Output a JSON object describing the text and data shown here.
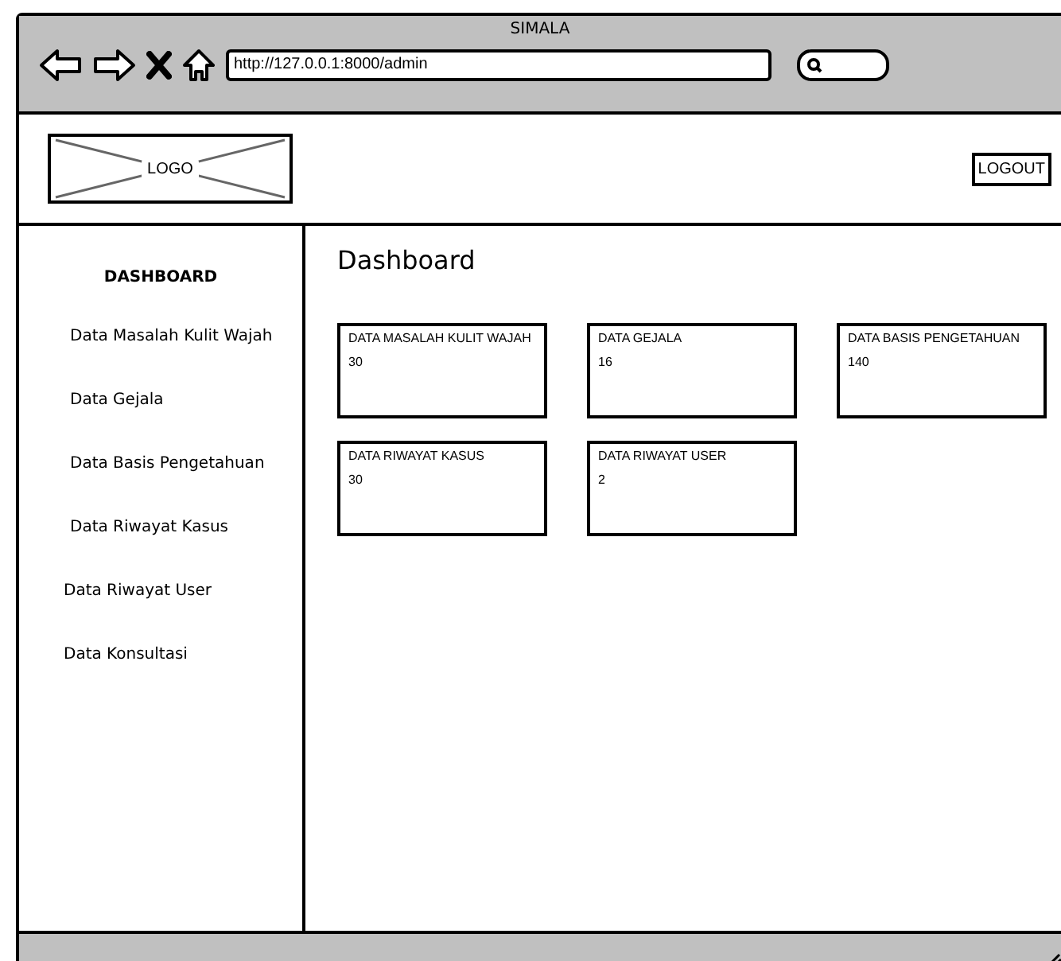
{
  "window": {
    "title": "SIMALA"
  },
  "browser": {
    "url": "http://127.0.0.1:8000/admin"
  },
  "header": {
    "logo": "LOGO",
    "logout": "LOGOUT"
  },
  "sidebar": {
    "title": "DASHBOARD",
    "items": [
      {
        "label": "Data Masalah Kulit Wajah"
      },
      {
        "label": "Data Gejala"
      },
      {
        "label": "Data Basis Pengetahuan"
      },
      {
        "label": "Data Riwayat Kasus"
      },
      {
        "label": "Data Riwayat User"
      },
      {
        "label": "Data Konsultasi"
      }
    ]
  },
  "main": {
    "heading": "Dashboard",
    "cards": [
      {
        "title": "DATA MASALAH KULIT WAJAH",
        "value": "30"
      },
      {
        "title": "DATA GEJALA",
        "value": "16"
      },
      {
        "title": "DATA BASIS PENGETAHUAN",
        "value": "140"
      },
      {
        "title": "DATA RIWAYAT KASUS",
        "value": "30"
      },
      {
        "title": "DATA RIWAYAT USER",
        "value": "2"
      }
    ]
  }
}
